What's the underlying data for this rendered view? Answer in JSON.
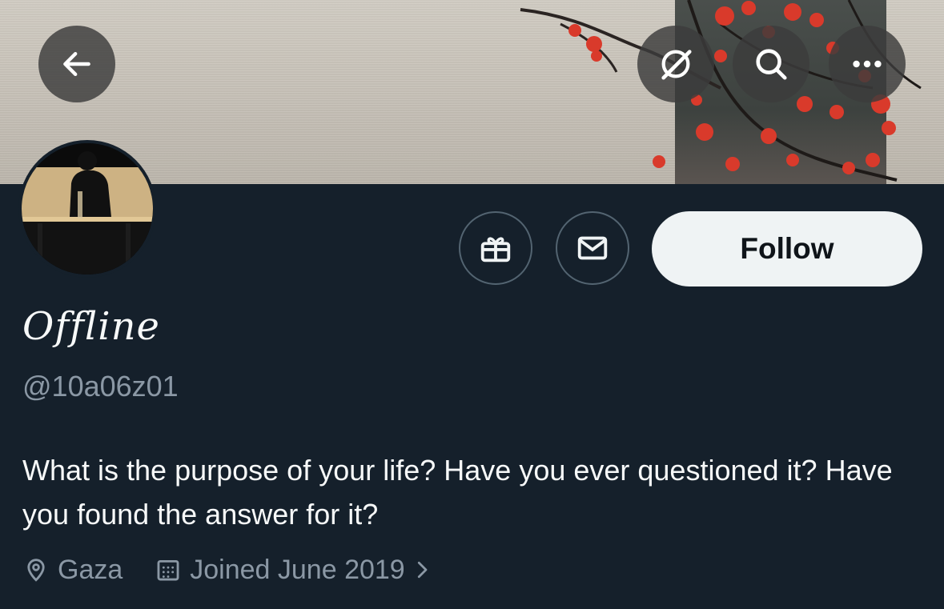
{
  "header": {
    "back_icon": "arrow-left-icon",
    "grok_icon": "grok-icon",
    "search_icon": "search-icon",
    "more_icon": "more-horizontal-icon"
  },
  "profile": {
    "display_name": "Offline",
    "handle": "@10a06z01",
    "bio": "What is the purpose of your life? Have you ever questioned it? Have you found the answer for it?",
    "location": "Gaza",
    "joined": "Joined June 2019"
  },
  "actions": {
    "gift_icon": "gift-icon",
    "message_icon": "envelope-icon",
    "follow_label": "Follow"
  },
  "colors": {
    "background": "#15202b",
    "secondary_text": "#8b98a5",
    "button_bg": "#eff3f4",
    "border": "#536471"
  }
}
